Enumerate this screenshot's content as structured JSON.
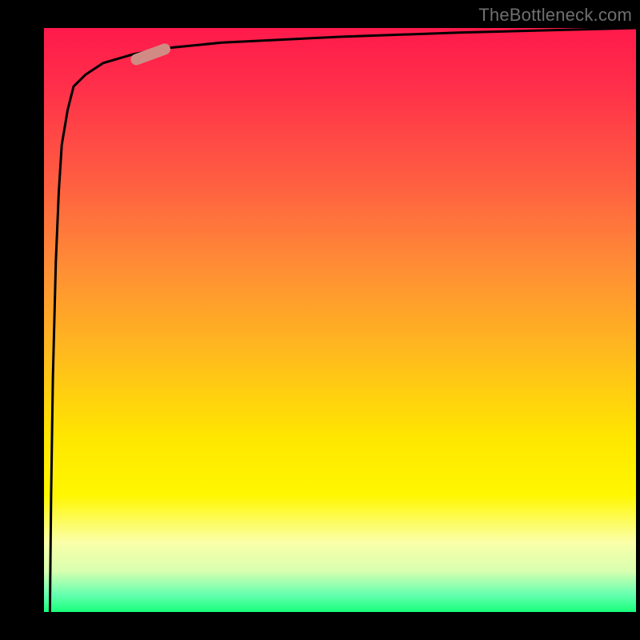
{
  "attribution": "TheBottleneck.com",
  "chart_data": {
    "type": "line",
    "title": "",
    "xlabel": "",
    "ylabel": "",
    "xlim": [
      0,
      1
    ],
    "ylim": [
      0,
      1
    ],
    "series": [
      {
        "name": "curve",
        "x": [
          0.01,
          0.012,
          0.015,
          0.02,
          0.025,
          0.03,
          0.04,
          0.05,
          0.07,
          0.1,
          0.15,
          0.2,
          0.3,
          0.5,
          0.7,
          1.0
        ],
        "y": [
          0.0,
          0.2,
          0.4,
          0.6,
          0.72,
          0.8,
          0.86,
          0.9,
          0.92,
          0.94,
          0.955,
          0.965,
          0.975,
          0.985,
          0.992,
          1.0
        ]
      }
    ],
    "marker": {
      "name": "capsule-marker",
      "x": 0.18,
      "y": 0.955,
      "angle_deg": -20,
      "length": 0.07,
      "color": "#d18b85"
    }
  }
}
